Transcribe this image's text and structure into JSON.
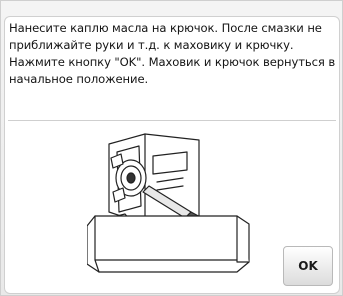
{
  "dialog": {
    "message_lines": [
      "Нанесите каплю масла на крючок. После смазки не",
      "приближайте руки и т.д. к маховику и крючку.",
      "Нажмите кнопку \"OK\". Маховик и крючок вернуться в",
      "начальное положение."
    ],
    "ok_label": "OK"
  },
  "illustration": {
    "icon": "oil-hook-illustration"
  }
}
